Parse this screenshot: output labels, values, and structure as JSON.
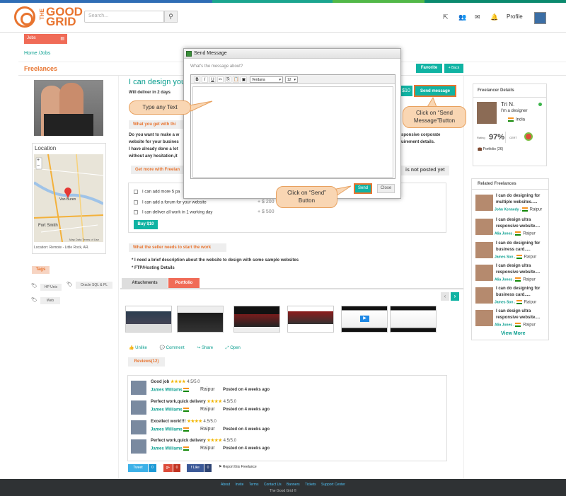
{
  "header": {
    "logo_small": "THE",
    "logo_line1": "GOOD",
    "logo_line2": "GRID",
    "search_placeholder": "Search...",
    "profile_label": "Profile",
    "icons": [
      "external-link-icon",
      "users-icon",
      "envelope-icon",
      "bell-icon"
    ]
  },
  "nav": {
    "jobs_label": "Jobs",
    "breadcrumb": "Home /Jobs",
    "page_heading": "Freelances",
    "favorite_label": "Favorite",
    "back_label": "+ Back"
  },
  "sidebar": {
    "location_title": "Location",
    "map_labels": [
      "Van Buren",
      "Fort Smith"
    ],
    "map_attribution": "Map Data   Terms of Use",
    "location_text": "Location: Remote - Little Rock, AR.",
    "tags_title": "Tags",
    "tags": [
      "HP Unix",
      "Oracle SQL & PL",
      "Web"
    ]
  },
  "gig": {
    "title": "I can design your",
    "deliver": "Will deliver in 2 days",
    "price_label": "$10",
    "send_message_label": "Send message",
    "section_get": "What you get with thi",
    "description": [
      "Do you want to make a w",
      "website for your busines",
      "I have already done a lot",
      "without any hesitation,it"
    ],
    "description_right": [
      "sponsive corporate",
      "uirement details."
    ],
    "section_more": "Get more with Freelan",
    "not_posted": "is not posted yet",
    "extras": [
      {
        "label": "I can add more 5 pa",
        "price": ""
      },
      {
        "label": "I can add a forum for your website",
        "price": "+ $  200"
      },
      {
        "label": "I can deliver all work in 1 working day",
        "price": "+ $  500"
      }
    ],
    "buy_label": "Buy $10",
    "section_needs": "What the seller needs to start the work",
    "needs": [
      "* I need a brief description about the website to design with some sample websites",
      "* FTP/Hosting Details"
    ],
    "tab_attachments": "Attachments",
    "tab_portfolio": "Portfolio",
    "actions": [
      "Unlike",
      "Comment",
      "Share",
      "Open"
    ],
    "reviews_label": "Reviews(12)",
    "reviews": [
      {
        "title": "Good job",
        "stars": "★★★★",
        "score": "4.5/5.0",
        "name": "James Williams",
        "city": "Raipur",
        "posted": "Posted on 4 weeks ago"
      },
      {
        "title": "Perfect work,quick delivery",
        "stars": "★★★★",
        "score": "4.5/5.0",
        "name": "James Williams",
        "city": "Raipur",
        "posted": "Posted on 4 weeks ago"
      },
      {
        "title": "Excellect work!!!!",
        "stars": "★★★★",
        "score": "4.5/5.0",
        "name": "James Williams",
        "city": "Raipur",
        "posted": "Posted on 4 weeks ago"
      },
      {
        "title": "Perfect work,quick delivery",
        "stars": "★★★★",
        "score": "4.5/5.0",
        "name": "James Williams",
        "city": "Raipur",
        "posted": "Posted on 4 weeks ago"
      }
    ],
    "social": {
      "tweet": "Tweet",
      "tweet_count": "0",
      "gplus": "g+",
      "gplus_count": "0",
      "like": "f Like",
      "like_count": "0",
      "report": "Report this Freelance"
    }
  },
  "freelancer": {
    "title": "Freelancer Details",
    "name": "Tri N.",
    "role": "I'm a designer",
    "country": "India",
    "rating_label": "Rating",
    "rating": "97%",
    "cert_label": "CERT",
    "portfolio": "Portfolio (26)"
  },
  "related": {
    "title": "Related Freelances",
    "items": [
      {
        "title": "I can do designing for multiple websites.....",
        "name": "John Kennedy",
        "city": "Raipur"
      },
      {
        "title": "I can design ultra responsive website....",
        "name": "Alia Jones",
        "city": "Raipur"
      },
      {
        "title": "I can do designing for business card.....",
        "name": "James Son",
        "city": "Raipur"
      },
      {
        "title": "I can design ultra responsive website....",
        "name": "Alia Jones",
        "city": "Raipur"
      },
      {
        "title": "I can do designing for business card.....",
        "name": "James Son",
        "city": "Raipur"
      },
      {
        "title": "I can design ultra responsive website....",
        "name": "Alia Jones",
        "city": "Raipur"
      }
    ],
    "view_more": "View More"
  },
  "footer": {
    "links": [
      "About",
      "Invite",
      "Terms",
      "Contact Us",
      "Banners",
      "Tickets",
      "Support Center"
    ],
    "copyright": "The Good Grid ©"
  },
  "modal": {
    "title": "Send Message",
    "question_placeholder": "What's the message about?",
    "font": "Verdana",
    "size": "12",
    "send_label": "Send",
    "close_label": "Close"
  },
  "callouts": {
    "type_text": "Type any Text",
    "send_message": "Click on “Send Message”Button",
    "send": "Click on “Send” Button"
  },
  "colors": {
    "accent": "#10b3a3",
    "brand": "#e8742f",
    "highlight": "#f06b57"
  }
}
